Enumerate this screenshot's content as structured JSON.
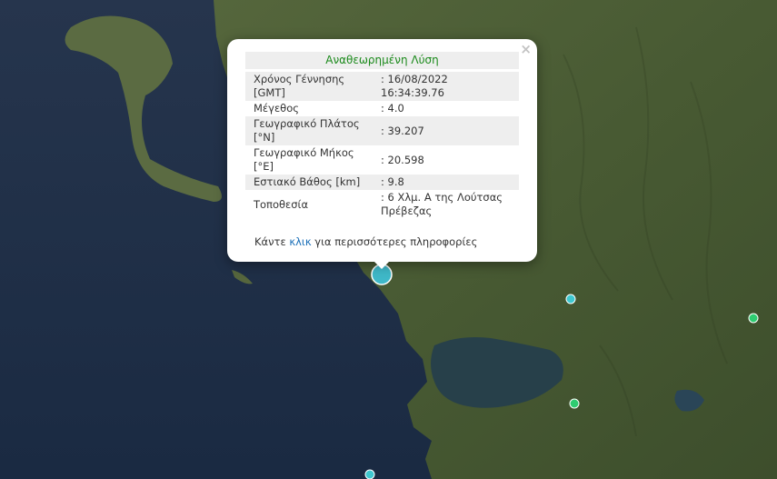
{
  "popup": {
    "title": "Αναθεωρημένη Λύση",
    "rows": [
      {
        "label": "Χρόνος Γέννησης [GMT]",
        "value": ": 16/08/2022 16:34:39.76"
      },
      {
        "label": "Μέγεθος",
        "value": ": 4.0"
      },
      {
        "label": "Γεωγραφικό Πλάτος [°N]",
        "value": ": 39.207"
      },
      {
        "label": "Γεωγραφικό Μήκος [°E]",
        "value": ": 20.598"
      },
      {
        "label": "Εστιακό Βάθος [km]",
        "value": ": 9.8"
      },
      {
        "label": "Τοποθεσία",
        "value": ": 6 Χλμ. Α της Λούτσας Πρέβεζας"
      }
    ],
    "footer_before": "Κάντε ",
    "footer_link": "κλικ",
    "footer_after": " για περισσότερες πληροφορίες",
    "close_symbol": "×"
  },
  "markers": {
    "main": {
      "color": "#3fb8c8"
    },
    "others": [
      {
        "color": "#3fc8d0"
      },
      {
        "color": "#2ecc71"
      },
      {
        "color": "#2ecc71"
      },
      {
        "color": "#3fc8d0"
      }
    ]
  },
  "colors": {
    "sea": "#1f2f47",
    "land": "#4a5a34",
    "lagoon": "#27404a",
    "title_text": "#1b8a1b",
    "link": "#1a6fb8"
  }
}
